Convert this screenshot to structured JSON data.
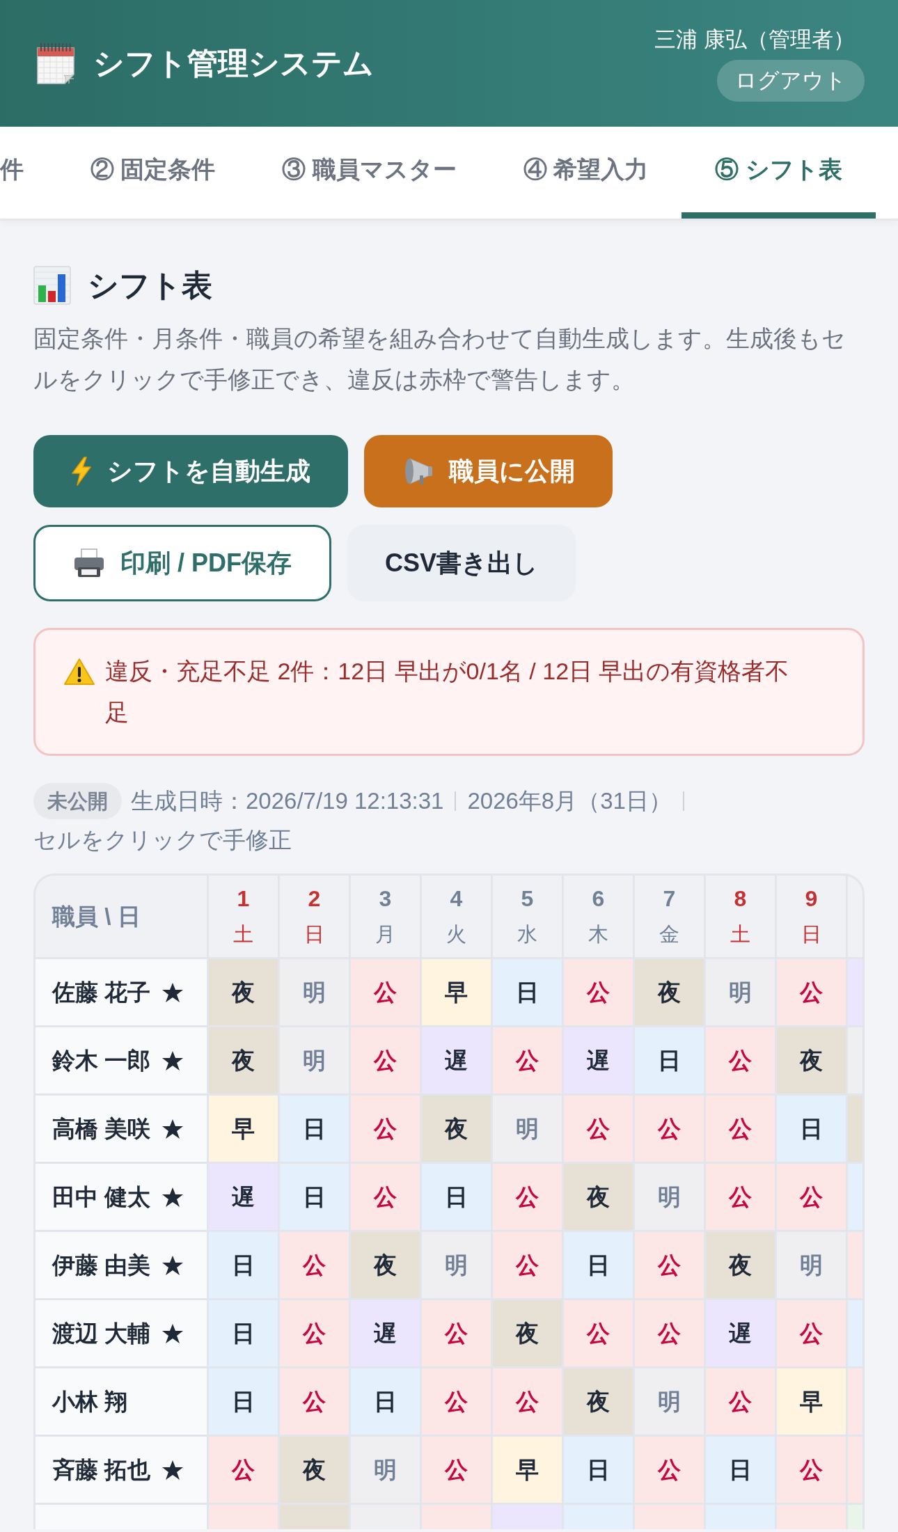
{
  "header": {
    "title": "シフト管理システム",
    "user": "三浦 康弘（管理者）",
    "logout": "ログアウト"
  },
  "tabs": [
    {
      "label": "件",
      "selected": false
    },
    {
      "label": "② 固定条件",
      "selected": false
    },
    {
      "label": "③ 職員マスター",
      "selected": false
    },
    {
      "label": "④ 希望入力",
      "selected": false
    },
    {
      "label": "⑤ シフト表",
      "selected": true
    }
  ],
  "section": {
    "title": "シフト表",
    "description": "固定条件・月条件・職員の希望を組み合わせて自動生成します。生成後もセルをクリックで手修正でき、違反は赤枠で警告します。"
  },
  "actions": [
    {
      "label": "シフトを自動生成",
      "kind": "primary"
    },
    {
      "label": "職員に公開",
      "kind": "accent"
    },
    {
      "label": "印刷 / PDF保存",
      "kind": "outline"
    },
    {
      "label": "CSV書き出し",
      "kind": "plain"
    }
  ],
  "alert": {
    "message": "違反・充足不足 2件：12日 早出が0/1名 / 12日 早出の有資格者不足"
  },
  "status": {
    "badge": "未公開",
    "items": [
      "生成日時：2026/7/19 12:13:31",
      "2026年8月（31日）",
      "セルをクリックで手修正"
    ]
  },
  "table": {
    "corner": "職員 \\ 日",
    "days": [
      {
        "day": "1",
        "weekday": "土",
        "weekend": true
      },
      {
        "day": "2",
        "weekday": "日",
        "weekend": true
      },
      {
        "day": "3",
        "weekday": "月",
        "weekend": false
      },
      {
        "day": "4",
        "weekday": "火",
        "weekend": false
      },
      {
        "day": "5",
        "weekday": "水",
        "weekend": false
      },
      {
        "day": "6",
        "weekday": "木",
        "weekend": false
      },
      {
        "day": "7",
        "weekday": "金",
        "weekend": false
      },
      {
        "day": "8",
        "weekday": "土",
        "weekend": true
      },
      {
        "day": "9",
        "weekday": "日",
        "weekend": true
      }
    ],
    "rows": [
      {
        "name": "佐藤 花子",
        "starred": true,
        "cells": [
          {
            "shift": "夜",
            "kind": "night"
          },
          {
            "shift": "明",
            "kind": "postnight"
          },
          {
            "shift": "公",
            "kind": "off"
          },
          {
            "shift": "早",
            "kind": "early"
          },
          {
            "shift": "日",
            "kind": "day"
          },
          {
            "shift": "公",
            "kind": "off"
          },
          {
            "shift": "夜",
            "kind": "night"
          },
          {
            "shift": "明",
            "kind": "postnight"
          },
          {
            "shift": "公",
            "kind": "off"
          },
          {
            "kind": "late"
          }
        ]
      },
      {
        "name": "鈴木 一郎",
        "starred": true,
        "cells": [
          {
            "shift": "夜",
            "kind": "night"
          },
          {
            "shift": "明",
            "kind": "postnight"
          },
          {
            "shift": "公",
            "kind": "off"
          },
          {
            "shift": "遅",
            "kind": "late"
          },
          {
            "shift": "公",
            "kind": "off"
          },
          {
            "shift": "遅",
            "kind": "late"
          },
          {
            "shift": "日",
            "kind": "day"
          },
          {
            "shift": "公",
            "kind": "off"
          },
          {
            "shift": "夜",
            "kind": "night"
          },
          {
            "kind": "postnight"
          }
        ]
      },
      {
        "name": "高橋 美咲",
        "starred": true,
        "cells": [
          {
            "shift": "早",
            "kind": "early"
          },
          {
            "shift": "日",
            "kind": "day"
          },
          {
            "shift": "公",
            "kind": "off"
          },
          {
            "shift": "夜",
            "kind": "night"
          },
          {
            "shift": "明",
            "kind": "postnight"
          },
          {
            "shift": "公",
            "kind": "off"
          },
          {
            "shift": "公",
            "kind": "off"
          },
          {
            "shift": "公",
            "kind": "off"
          },
          {
            "shift": "日",
            "kind": "day"
          },
          {
            "kind": "night"
          }
        ]
      },
      {
        "name": "田中 健太",
        "starred": true,
        "cells": [
          {
            "shift": "遅",
            "kind": "late"
          },
          {
            "shift": "日",
            "kind": "day"
          },
          {
            "shift": "公",
            "kind": "off"
          },
          {
            "shift": "日",
            "kind": "day"
          },
          {
            "shift": "公",
            "kind": "off"
          },
          {
            "shift": "夜",
            "kind": "night"
          },
          {
            "shift": "明",
            "kind": "postnight"
          },
          {
            "shift": "公",
            "kind": "off"
          },
          {
            "shift": "公",
            "kind": "off"
          },
          {
            "kind": "day"
          }
        ]
      },
      {
        "name": "伊藤 由美",
        "starred": true,
        "cells": [
          {
            "shift": "日",
            "kind": "day"
          },
          {
            "shift": "公",
            "kind": "off"
          },
          {
            "shift": "夜",
            "kind": "night"
          },
          {
            "shift": "明",
            "kind": "postnight"
          },
          {
            "shift": "公",
            "kind": "off"
          },
          {
            "shift": "日",
            "kind": "day"
          },
          {
            "shift": "公",
            "kind": "off"
          },
          {
            "shift": "夜",
            "kind": "night"
          },
          {
            "shift": "明",
            "kind": "postnight"
          },
          {
            "kind": "off"
          }
        ]
      },
      {
        "name": "渡辺 大輔",
        "starred": true,
        "cells": [
          {
            "shift": "日",
            "kind": "day"
          },
          {
            "shift": "公",
            "kind": "off"
          },
          {
            "shift": "遅",
            "kind": "late"
          },
          {
            "shift": "公",
            "kind": "off"
          },
          {
            "shift": "夜",
            "kind": "night"
          },
          {
            "shift": "公",
            "kind": "off"
          },
          {
            "shift": "公",
            "kind": "off"
          },
          {
            "shift": "遅",
            "kind": "late"
          },
          {
            "shift": "公",
            "kind": "off"
          },
          {
            "kind": "day"
          }
        ]
      },
      {
        "name": "小林 翔",
        "starred": false,
        "cells": [
          {
            "shift": "日",
            "kind": "day"
          },
          {
            "shift": "公",
            "kind": "off"
          },
          {
            "shift": "日",
            "kind": "day"
          },
          {
            "shift": "公",
            "kind": "off"
          },
          {
            "shift": "公",
            "kind": "off"
          },
          {
            "shift": "夜",
            "kind": "night"
          },
          {
            "shift": "明",
            "kind": "postnight"
          },
          {
            "shift": "公",
            "kind": "off"
          },
          {
            "shift": "早",
            "kind": "early"
          },
          {
            "kind": "off"
          }
        ]
      },
      {
        "name": "斉藤 拓也",
        "starred": true,
        "cells": [
          {
            "shift": "公",
            "kind": "off"
          },
          {
            "shift": "夜",
            "kind": "night"
          },
          {
            "shift": "明",
            "kind": "postnight"
          },
          {
            "shift": "公",
            "kind": "off"
          },
          {
            "shift": "早",
            "kind": "early"
          },
          {
            "shift": "日",
            "kind": "day"
          },
          {
            "shift": "公",
            "kind": "off"
          },
          {
            "shift": "日",
            "kind": "day"
          },
          {
            "shift": "公",
            "kind": "off"
          },
          {
            "kind": "off"
          }
        ]
      }
    ],
    "cut_row": {
      "cells": [
        {
          "kind": "off"
        },
        {
          "kind": "night"
        },
        {
          "kind": "postnight"
        },
        {
          "kind": "off"
        },
        {
          "kind": "late"
        },
        {
          "kind": "day"
        },
        {
          "kind": "off"
        },
        {
          "kind": "day"
        },
        {
          "kind": "off"
        },
        {
          "kind": "other"
        }
      ]
    }
  }
}
